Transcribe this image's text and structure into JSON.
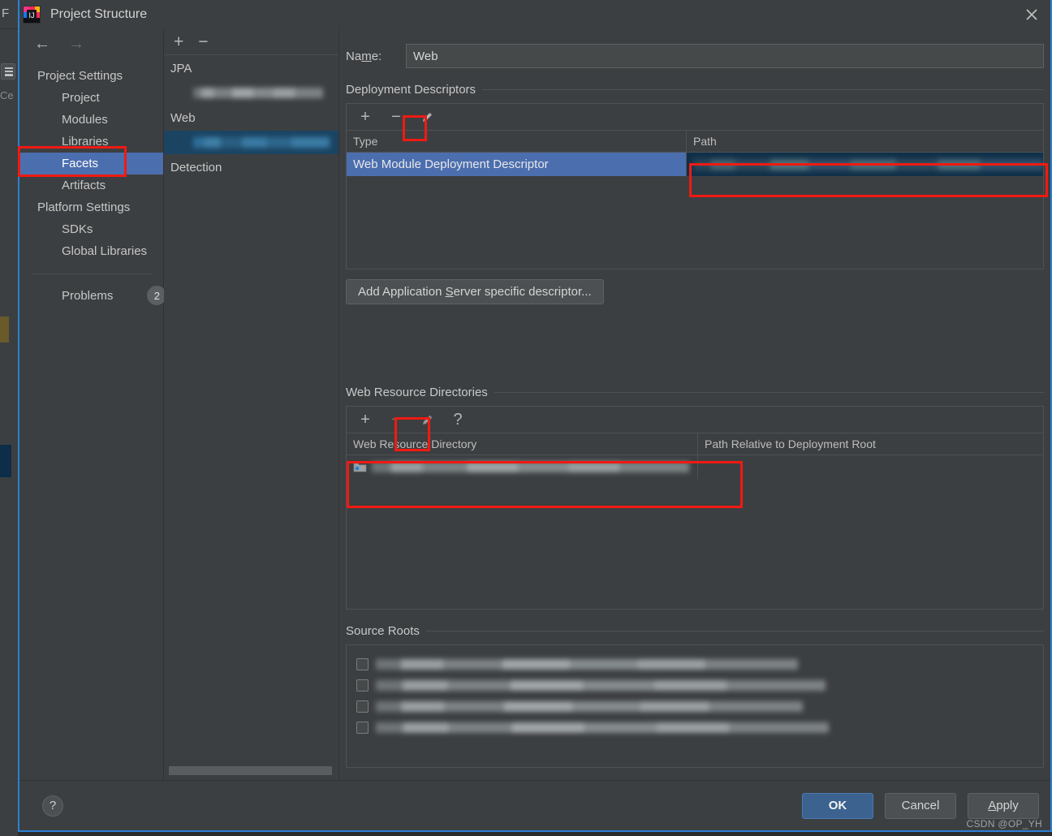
{
  "window": {
    "title": "Project Structure",
    "app_icon": "intellij-idea-icon",
    "close_icon": "close-icon"
  },
  "background_ide": {
    "menu_letter": "F",
    "editor_tab_label": "Ce",
    "structure_icon": "structure-toggle-icon"
  },
  "sidebar": {
    "back_icon": "back-arrow-icon",
    "forward_icon": "forward-arrow-icon",
    "items": [
      {
        "label": "Project Settings",
        "type": "group"
      },
      {
        "label": "Project",
        "type": "child"
      },
      {
        "label": "Modules",
        "type": "child"
      },
      {
        "label": "Libraries",
        "type": "child"
      },
      {
        "label": "Facets",
        "type": "child",
        "selected": true
      },
      {
        "label": "Artifacts",
        "type": "child"
      },
      {
        "label": "Platform Settings",
        "type": "group"
      },
      {
        "label": "SDKs",
        "type": "child"
      },
      {
        "label": "Global Libraries",
        "type": "child"
      }
    ],
    "problems": {
      "label": "Problems",
      "count": "2"
    }
  },
  "facet_panel": {
    "toolbar": {
      "add_icon": "plus-icon",
      "remove_icon": "minus-icon",
      "add_label": "+",
      "remove_label": "−"
    },
    "groups": [
      {
        "label": "JPA",
        "child_redacted": true,
        "child_selected": false
      },
      {
        "label": "Web",
        "child_redacted": true,
        "child_selected": true
      },
      {
        "label": "Detection",
        "child_redacted": false,
        "child_selected": false
      }
    ]
  },
  "content": {
    "name": {
      "label_pre": "Na",
      "label_accel": "m",
      "label_post": "e:",
      "value": "Web",
      "placeholder": ""
    },
    "deployment_descriptors": {
      "title": "Deployment Descriptors",
      "toolbar": {
        "add_label": "+",
        "add_icon": "plus-icon",
        "remove_label": "−",
        "remove_icon": "minus-icon",
        "edit_icon": "pencil-edit-icon"
      },
      "columns": [
        "Type",
        "Path"
      ],
      "rows": [
        {
          "type": "Web Module Deployment Descriptor",
          "path_redacted": true,
          "selected": true
        }
      ],
      "add_server_descriptor_button": {
        "pre": "Add Application ",
        "accel": "S",
        "post": "erver specific descriptor..."
      }
    },
    "web_resource_directories": {
      "title": "Web Resource Directories",
      "toolbar": {
        "add_label": "+",
        "add_icon": "plus-icon",
        "remove_label": "−",
        "remove_icon": "minus-icon",
        "edit_icon": "pencil-edit-icon",
        "help_label": "?",
        "help_icon": "question-mark-icon"
      },
      "columns": [
        "Web Resource Directory",
        "Path Relative to Deployment Root"
      ],
      "rows": [
        {
          "directory_redacted": true,
          "relative_path": "",
          "icon": "folder-icon"
        }
      ]
    },
    "source_roots": {
      "title": "Source Roots",
      "rows": [
        {
          "checked": false,
          "label_redacted": true
        },
        {
          "checked": false,
          "label_redacted": true
        },
        {
          "checked": false,
          "label_redacted": true
        },
        {
          "checked": false,
          "label_redacted": true
        }
      ]
    }
  },
  "footer": {
    "help_label": "?",
    "help_icon": "question-mark-icon",
    "ok": "OK",
    "cancel": "Cancel",
    "apply_pre": "",
    "apply_accel": "A",
    "apply_post": "pply",
    "apply": "Apply",
    "watermark": "CSDN @OP_YH"
  },
  "annotations": {
    "color": "#f01a12",
    "boxes": [
      {
        "name": "facets-sidebar-highlight"
      },
      {
        "name": "descriptor-edit-button-highlight"
      },
      {
        "name": "descriptor-path-highlight"
      },
      {
        "name": "webres-edit-button-highlight"
      },
      {
        "name": "webres-row-highlight"
      }
    ]
  }
}
